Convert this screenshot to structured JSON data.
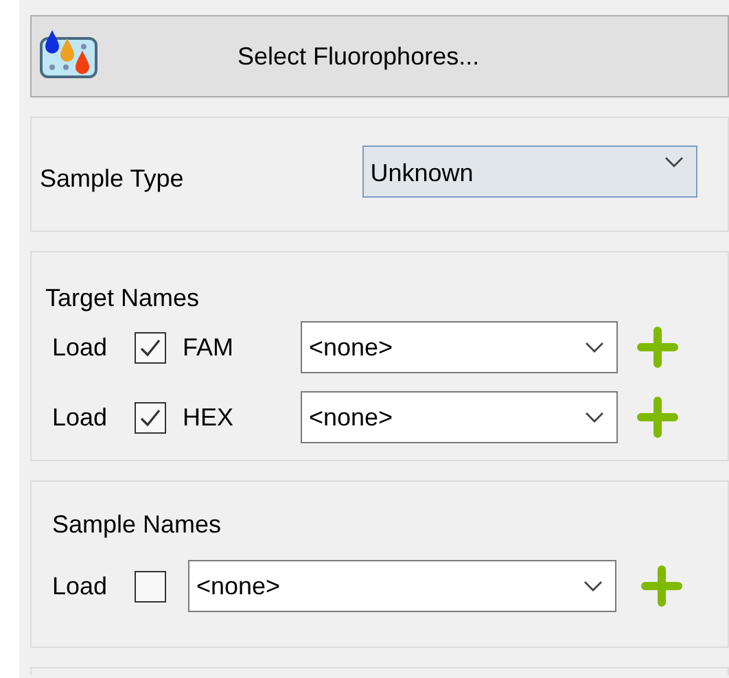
{
  "select_fluorophores_button": {
    "label": "Select Fluorophores..."
  },
  "sample_type": {
    "label": "Sample Type",
    "value": "Unknown"
  },
  "target_names": {
    "title": "Target Names",
    "rows": [
      {
        "load_label": "Load",
        "checked": true,
        "fluorophore": "FAM",
        "value": "<none>"
      },
      {
        "load_label": "Load",
        "checked": true,
        "fluorophore": "HEX",
        "value": "<none>"
      }
    ]
  },
  "sample_names": {
    "title": "Sample Names",
    "load_label": "Load",
    "checked": false,
    "value": "<none>"
  }
}
